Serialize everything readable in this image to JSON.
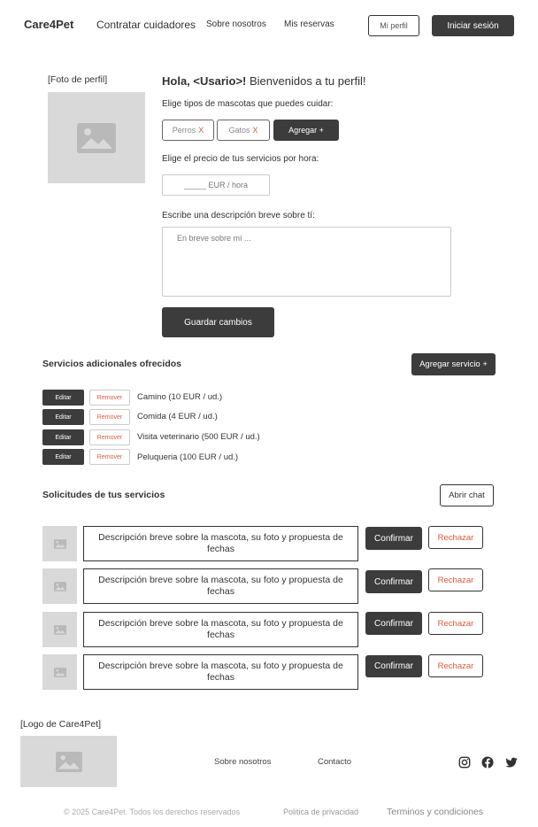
{
  "header": {
    "brand": "Care4Pet",
    "nav": [
      "Contratar cuidadores",
      "Sobre nosotros",
      "Mis reservas"
    ],
    "profile_button": "Mi perfil",
    "login_button": "Iniciar sesión"
  },
  "profile": {
    "photo_label": "[Foto de perfil]",
    "greeting_bold": "Hola, <Usario>!",
    "greeting_rest": " Bienvenidos a tu perfil!",
    "pet_types_label": "Elige tipos de mascotas que puedes cuidar:",
    "pet_types": [
      {
        "label": "Perros",
        "remove": "X"
      },
      {
        "label": "Gatos",
        "remove": "X"
      }
    ],
    "add_button": "Agregar +",
    "price_label": "Elige el precio de tus servicios por hora:",
    "price_placeholder": "_____ EUR / hora",
    "description_label": "Escribe una descripción breve sobre tí:",
    "description_placeholder": "En breve sobre mí ...",
    "save_button": "Guardar cambios"
  },
  "services": {
    "title": "Servicios adicionales ofrecidos",
    "add_button": "Agregar servicio +",
    "edit_label": "Editar",
    "remove_label": "Remover",
    "items": [
      "Camino (10 EUR / ud.)",
      "Comida (4 EUR / ud.)",
      "Visita veterinario (500 EUR / ud.)",
      "Peluqueria (100 EUR / ud.)"
    ]
  },
  "requests": {
    "title": "Solicitudes de tus servicios",
    "chat_button": "Abrir chat",
    "confirm_label": "Confirmar",
    "reject_label": "Rechazar",
    "items": [
      "Descripción breve sobre la mascota, su foto y propuesta de fechas",
      "Descripción breve sobre la mascota, su foto y propuesta de fechas",
      "Descripción breve sobre la mascota, su foto y propuesta de fechas",
      "Descripción breve sobre la mascota, su foto y propuesta de fechas"
    ]
  },
  "footer": {
    "logo_label": "[Logo de Care4Pet]",
    "links": [
      "Sobre nosotros",
      "Contacto"
    ],
    "social": [
      "instagram-icon",
      "facebook-icon",
      "twitter-icon"
    ],
    "copyright": "© 2025 Care4Pet. Todos los derechos reservados",
    "privacy": "Politica de privacidad",
    "terms": "Terminos y condiciones"
  },
  "colors": {
    "dark_button": "#3c3c3c",
    "accent_remove": "#e05a3a",
    "placeholder": "#d9d9d9"
  }
}
